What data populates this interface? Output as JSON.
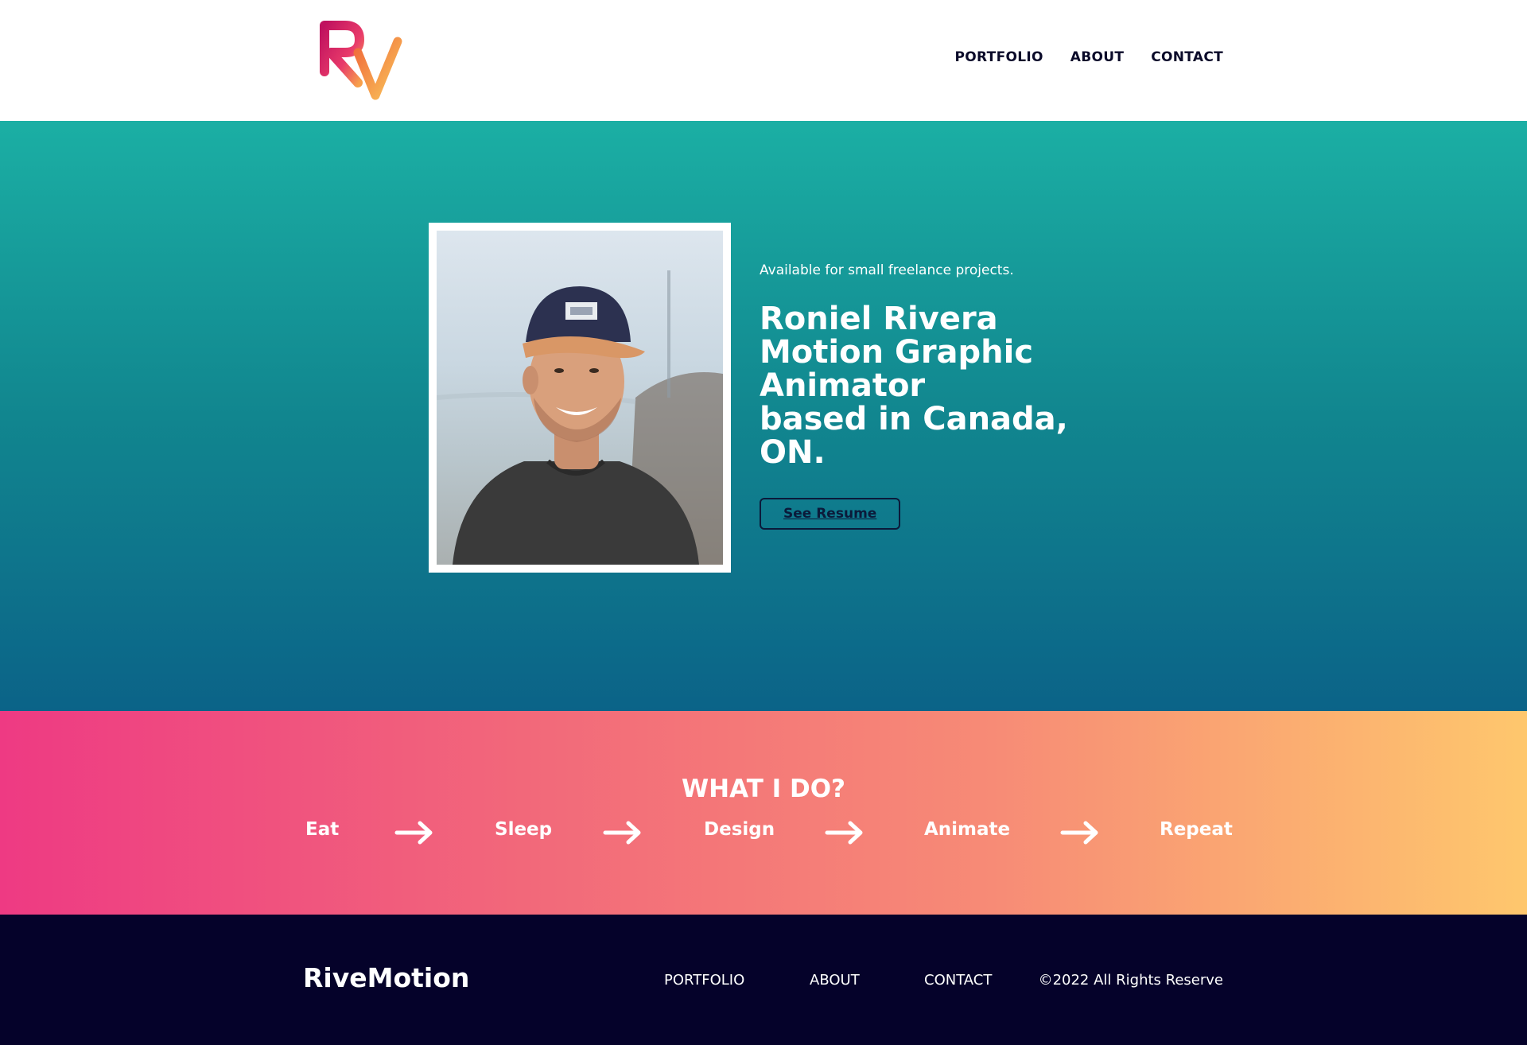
{
  "header": {
    "logo_alt": "RV",
    "nav": [
      "PORTFOLIO",
      "ABOUT",
      "CONTACT"
    ]
  },
  "hero": {
    "availability": "Available for small freelance projects.",
    "headline_lines": [
      "Roniel Rivera",
      "Motion Graphic",
      "Animator",
      "based in Canada,",
      "ON."
    ],
    "button_label": "See Resume"
  },
  "whatido": {
    "title": "WHAT I DO?",
    "steps": [
      "Eat",
      "Sleep",
      "Design",
      "Animate",
      "Repeat"
    ]
  },
  "footer": {
    "brand": "RiveMotion",
    "links": [
      "PORTFOLIO",
      "ABOUT",
      "CONTACT"
    ],
    "copyright": "©2022 All Rights Reserve"
  },
  "colors": {
    "hero_top": "#1bafa4",
    "hero_bottom": "#0b6388",
    "banner_left": "#ee3a83",
    "banner_right": "#fec76d",
    "footer_bg": "#05022a",
    "nav_text": "#0b0b2a"
  }
}
